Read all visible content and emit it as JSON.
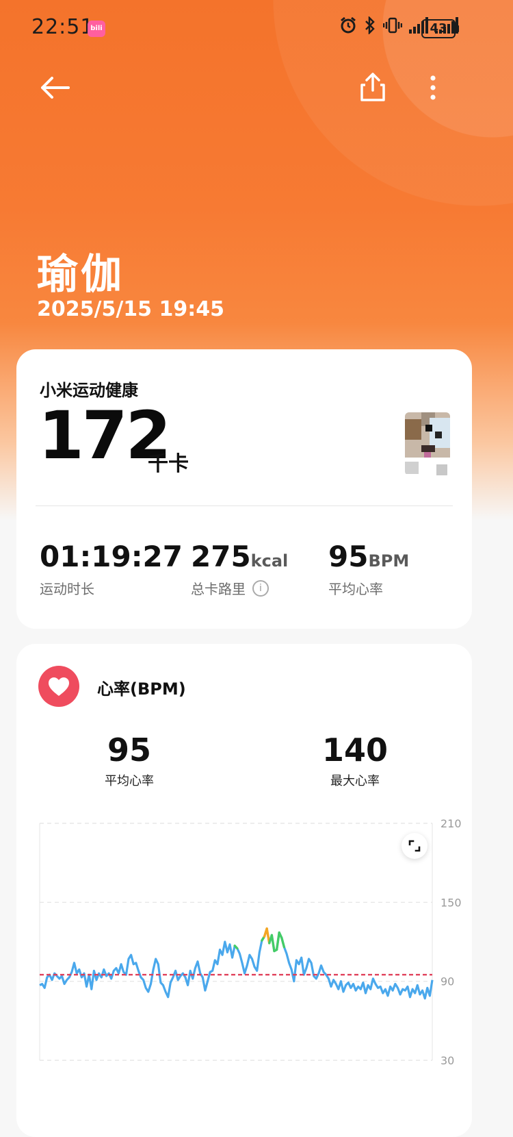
{
  "status_bar": {
    "time": "22:51",
    "app_badge": "bili",
    "battery": "43"
  },
  "header": {
    "title": "瑜伽",
    "datetime": "2025/5/15 19:45"
  },
  "summary_card": {
    "source": "小米运动健康",
    "calories": "172",
    "calories_unit": "千卡",
    "stats": [
      {
        "value": "01:19:27",
        "unit": "",
        "label": "运动时长"
      },
      {
        "value": "275",
        "unit": "kcal",
        "label": "总卡路里"
      },
      {
        "value": "95",
        "unit": "BPM",
        "label": "平均心率"
      }
    ]
  },
  "heart_rate_card": {
    "title": "心率(BPM)",
    "avg_value": "95",
    "avg_label": "平均心率",
    "max_value": "140",
    "max_label": "最大心率"
  },
  "chart_data": {
    "type": "line",
    "title": "心率(BPM)",
    "ylim": [
      30,
      210
    ],
    "yticks": [
      "210",
      "150",
      "90",
      "30"
    ],
    "reference_line": 95,
    "colors": {
      "line": "#4aa8ec",
      "high": "#44cc66",
      "peak": "#f5a623",
      "reference": "#e0405a"
    },
    "values": [
      87,
      88,
      85,
      93,
      95,
      91,
      96,
      94,
      92,
      94,
      88,
      91,
      93,
      97,
      104,
      96,
      99,
      93,
      96,
      86,
      95,
      84,
      98,
      91,
      96,
      93,
      99,
      94,
      96,
      92,
      98,
      100,
      96,
      103,
      97,
      95,
      107,
      110,
      103,
      104,
      98,
      93,
      91,
      85,
      82,
      88,
      99,
      107,
      103,
      89,
      87,
      82,
      78,
      89,
      93,
      98,
      91,
      94,
      96,
      93,
      87,
      98,
      92,
      100,
      105,
      96,
      93,
      83,
      90,
      97,
      98,
      106,
      103,
      114,
      110,
      120,
      112,
      118,
      108,
      117,
      115,
      111,
      104,
      96,
      102,
      110,
      107,
      101,
      98,
      112,
      121,
      124,
      130,
      119,
      125,
      113,
      114,
      127,
      123,
      116,
      111,
      104,
      99,
      90,
      106,
      103,
      108,
      95,
      100,
      107,
      104,
      94,
      92,
      96,
      102,
      97,
      95,
      92,
      86,
      91,
      88,
      84,
      90,
      82,
      87,
      89,
      85,
      88,
      83,
      86,
      84,
      89,
      81,
      87,
      84,
      92,
      88,
      85,
      86,
      81,
      84,
      79,
      86,
      83,
      88,
      85,
      80,
      84,
      83,
      86,
      78,
      84,
      81,
      87,
      80,
      83,
      77,
      85,
      79,
      91
    ]
  }
}
